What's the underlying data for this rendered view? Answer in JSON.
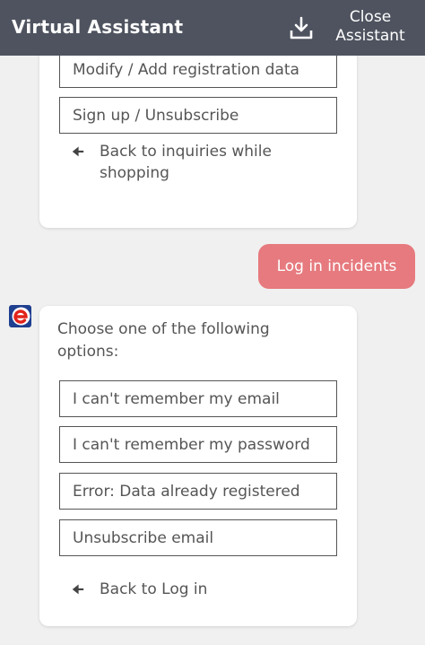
{
  "header": {
    "title": "Virtual Assistant",
    "download_icon": "download-icon",
    "close_label_line1": "Close",
    "close_label_line2": "Assistant"
  },
  "first_card": {
    "options": [
      "Modify / Add registration data",
      "Sign up / Unsubscribe"
    ],
    "back_line1": "Back to inquiries while",
    "back_line2": "shopping"
  },
  "user_message": "Log in incidents",
  "second_card": {
    "prompt_line1": "Choose one of the following",
    "prompt_line2": "options:",
    "options": [
      "I can't remember my email",
      "I can't remember my password",
      "Error: Data already registered",
      "Unsubscribe email"
    ],
    "back_label": "Back to Log in"
  },
  "colors": {
    "header_bg": "#4e535f",
    "user_bubble": "#e67a7e",
    "brand_red": "#e2231a",
    "brand_blue": "#1f3f8f"
  }
}
